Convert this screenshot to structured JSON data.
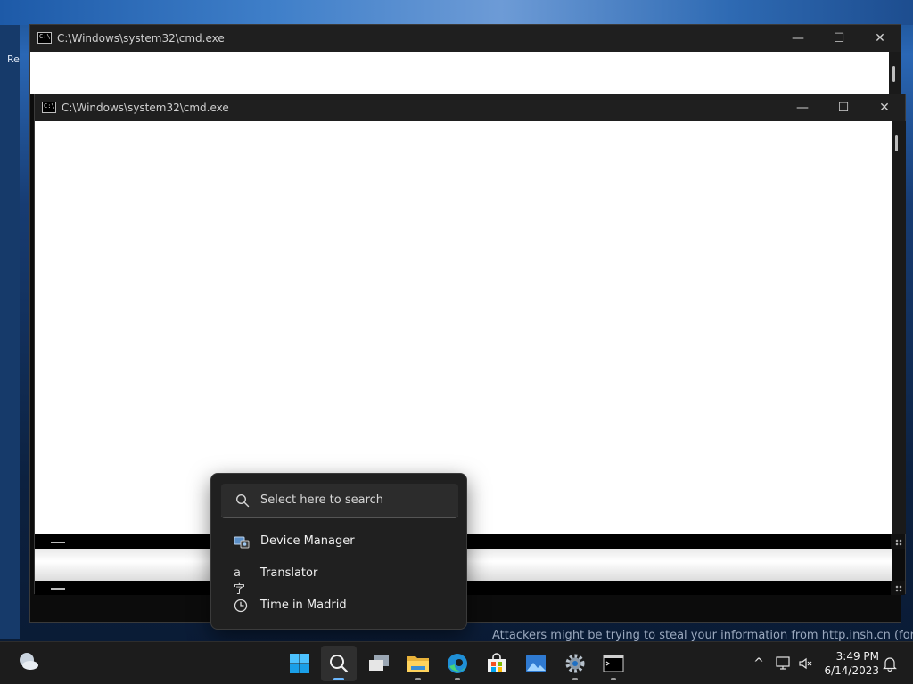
{
  "windows": [
    {
      "id": "cmd-back",
      "title": "C:\\Windows\\system32\\cmd.exe"
    },
    {
      "id": "cmd-front",
      "title": "C:\\Windows\\system32\\cmd.exe"
    }
  ],
  "window_controls": {
    "minimize": "—",
    "maximize": "☐",
    "close": "✕"
  },
  "desktop": {
    "edge_text": "Re",
    "bottom_text": "Attackers might be trying to steal your information from http.insh.cn (for exa"
  },
  "search_flyout": {
    "placeholder": "Select here to search",
    "results": [
      {
        "label": "Device Manager",
        "icon": "device-manager-icon"
      },
      {
        "label": "Translator",
        "icon": "translator-icon",
        "glyph": "a字"
      },
      {
        "label": "Time in Madrid",
        "icon": "clock-icon"
      }
    ]
  },
  "taskbar": {
    "apps": [
      {
        "name": "start-button",
        "icon": "windows-logo-icon"
      },
      {
        "name": "search-button",
        "icon": "search-icon",
        "active": true
      },
      {
        "name": "task-view-button",
        "icon": "task-view-icon"
      },
      {
        "name": "file-explorer-button",
        "icon": "folder-icon"
      },
      {
        "name": "edge-button",
        "icon": "edge-icon"
      },
      {
        "name": "store-button",
        "icon": "store-icon"
      },
      {
        "name": "photos-button",
        "icon": "photos-icon"
      },
      {
        "name": "settings-button",
        "icon": "gear-icon"
      },
      {
        "name": "terminal-button",
        "icon": "terminal-icon"
      }
    ],
    "tray": {
      "overflow_glyph": "^",
      "time": "3:49 PM",
      "date": "6/14/2023"
    }
  },
  "colors": {
    "taskbar_bg": "#1c1c1c",
    "flyout_bg": "#202020",
    "accent": "#6cb8ff"
  }
}
